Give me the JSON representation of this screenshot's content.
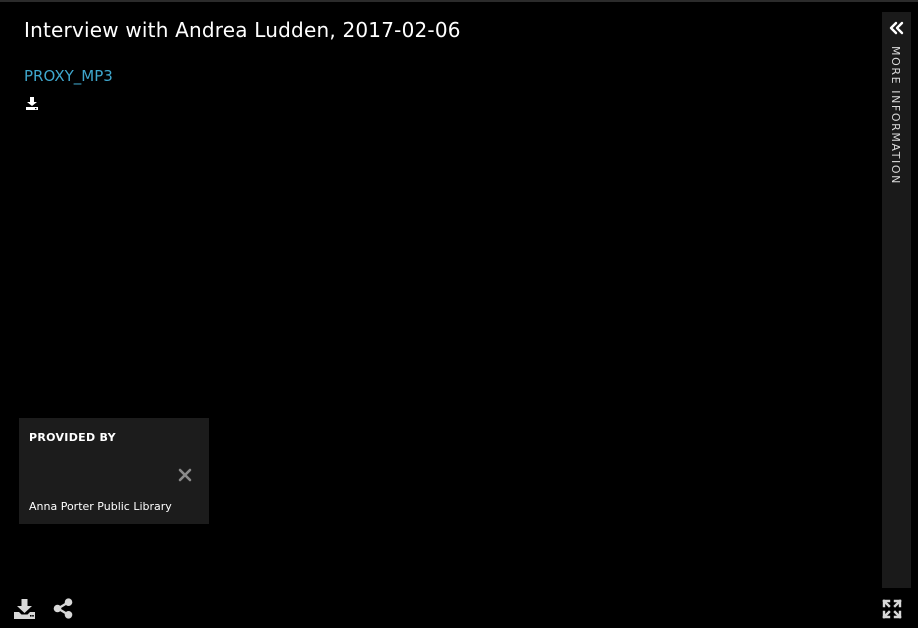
{
  "viewer": {
    "title": "Interview with Andrea Ludden, 2017-02-06",
    "file": {
      "label": "PROXY_MP3",
      "download_icon": "download-icon"
    }
  },
  "side_panel": {
    "label": "MORE INFORMATION",
    "icon": "double-chevron-left-icon"
  },
  "provider": {
    "heading": "PROVIDED BY",
    "name": "Anna Porter Public Library",
    "close_icon": "close-icon"
  },
  "toolbar": {
    "download_icon": "download-tray-icon",
    "share_icon": "share-icon",
    "fullscreen_icon": "fullscreen-icon"
  },
  "colors": {
    "background": "#000000",
    "link": "#3fa7cd",
    "panel": "#1a1a1a",
    "provider_box": "#1c1c1c",
    "text": "#ffffff"
  }
}
